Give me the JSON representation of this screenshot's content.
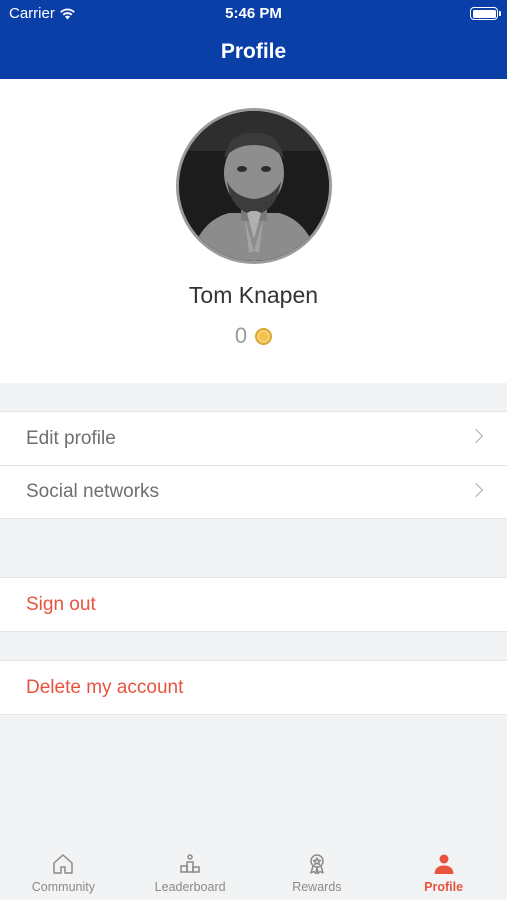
{
  "status_bar": {
    "carrier": "Carrier",
    "time": "5:46 PM"
  },
  "header": {
    "title": "Profile",
    "background": "#0b3fa8"
  },
  "profile": {
    "name": "Tom Knapen",
    "points": "0",
    "coin_icon": "coin-icon"
  },
  "menu": {
    "group1": [
      {
        "label": "Edit profile"
      },
      {
        "label": "Social networks"
      }
    ],
    "sign_out": "Sign out",
    "delete_account": "Delete my account"
  },
  "tabs": [
    {
      "label": "Community",
      "icon": "home-icon"
    },
    {
      "label": "Leaderboard",
      "icon": "podium-icon"
    },
    {
      "label": "Rewards",
      "icon": "award-icon"
    },
    {
      "label": "Profile",
      "icon": "person-icon",
      "active": true
    }
  ],
  "colors": {
    "accent": "#e8533f",
    "brand": "#0b3fa8",
    "coin": "#f3c14c"
  }
}
